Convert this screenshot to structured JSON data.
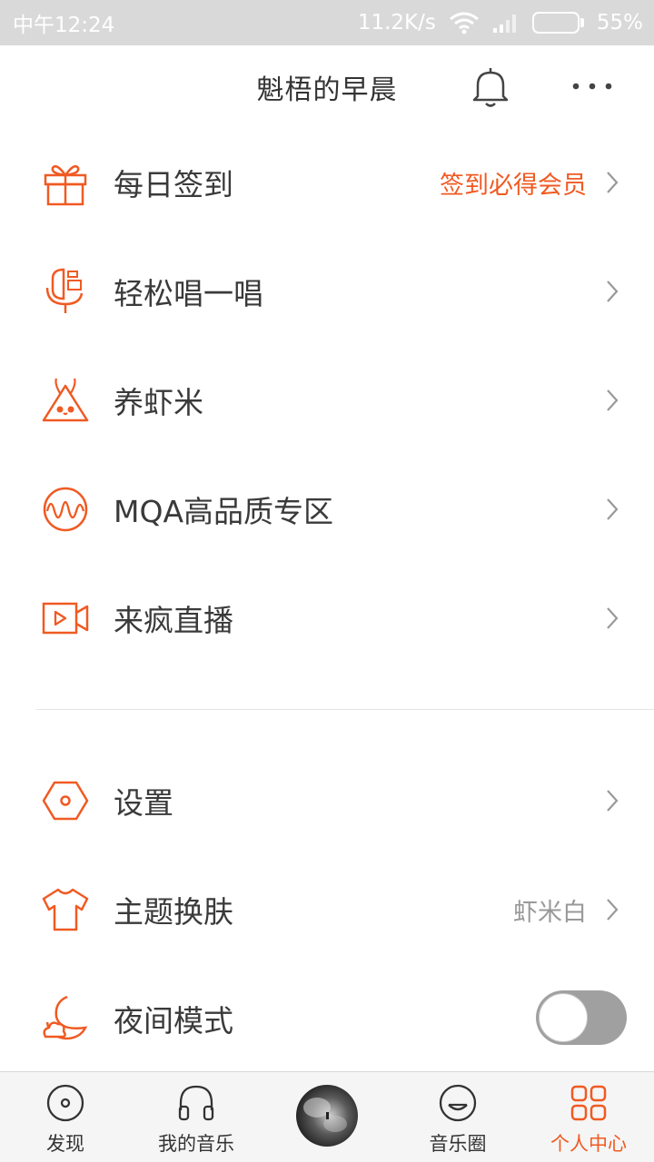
{
  "status_bar": {
    "time": "中午12:24",
    "speed": "11.2K/s",
    "battery": "55%",
    "battery_level": 0.55
  },
  "header": {
    "title": "魁梧的早晨",
    "bell_icon": "bell-icon",
    "more_icon": "more-icon"
  },
  "menu": [
    {
      "label": "每日签到",
      "value": "签到必得会员",
      "icon": "gift-icon"
    },
    {
      "label": "轻松唱一唱",
      "value": "",
      "icon": "microphone-icon"
    },
    {
      "label": "养虾米",
      "value": "",
      "icon": "shrimp-pet-icon"
    },
    {
      "label": "MQA高品质专区",
      "value": "",
      "icon": "mqa-waveform-icon"
    },
    {
      "label": "来疯直播",
      "value": "",
      "icon": "live-video-icon"
    }
  ],
  "settings_menu": [
    {
      "label": "设置",
      "value": "",
      "icon": "hexagon-settings-icon"
    },
    {
      "label": "主题换肤",
      "value": "虾米白",
      "icon": "tshirt-icon"
    },
    {
      "label": "夜间模式",
      "toggle_on": false,
      "icon": "moon-cloud-icon"
    }
  ],
  "tabbar": [
    {
      "label": "发现",
      "icon": "disc-icon",
      "active": false
    },
    {
      "label": "我的音乐",
      "icon": "headphones-icon",
      "active": false
    },
    {
      "label": "音乐圈",
      "icon": "smile-icon",
      "active": false
    },
    {
      "label": "个人中心",
      "icon": "grid-icon",
      "active": true
    }
  ],
  "colors": {
    "accent": "#f05a22",
    "status_bar": "#d9d9d9",
    "toggle_off": "#a0a0a0"
  }
}
